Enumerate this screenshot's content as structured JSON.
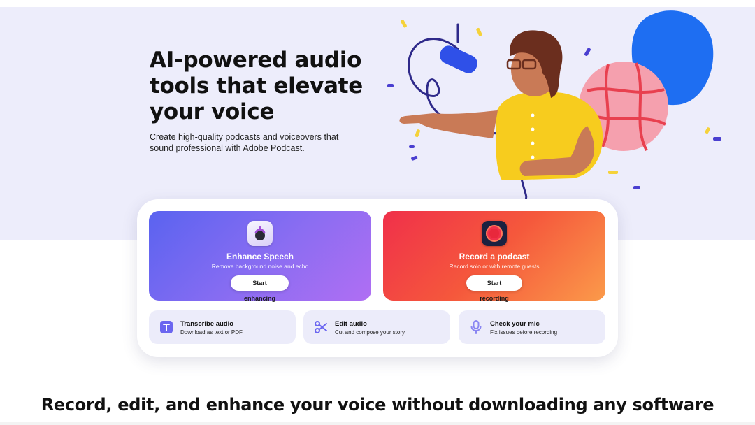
{
  "hero": {
    "title": "AI-powered audio tools that elevate your voice",
    "subtitle": "Create high-quality podcasts and voiceovers that sound professional with Adobe Podcast."
  },
  "tools": {
    "enhance": {
      "title": "Enhance Speech",
      "description": "Remove background noise and echo",
      "button": "Start enhancing",
      "icon": "enhance-speech-app-icon"
    },
    "record": {
      "title": "Record a podcast",
      "description": "Record solo or with remote guests",
      "button": "Start recording",
      "icon": "record-app-icon"
    },
    "small": [
      {
        "title": "Transcribe audio",
        "description": "Download as text or PDF",
        "icon": "transcribe-icon"
      },
      {
        "title": "Edit audio",
        "description": "Cut and compose your story",
        "icon": "scissors-icon"
      },
      {
        "title": "Check your mic",
        "description": "Fix issues before recording",
        "icon": "microphone-icon"
      }
    ]
  },
  "section": {
    "title": "Record, edit, and enhance your voice without downloading any software"
  },
  "colors": {
    "hero_bg": "#ededfb",
    "accent_purple": "#6b66f0",
    "accent_red": "#f0304a",
    "card_bg": "#ececfa"
  }
}
